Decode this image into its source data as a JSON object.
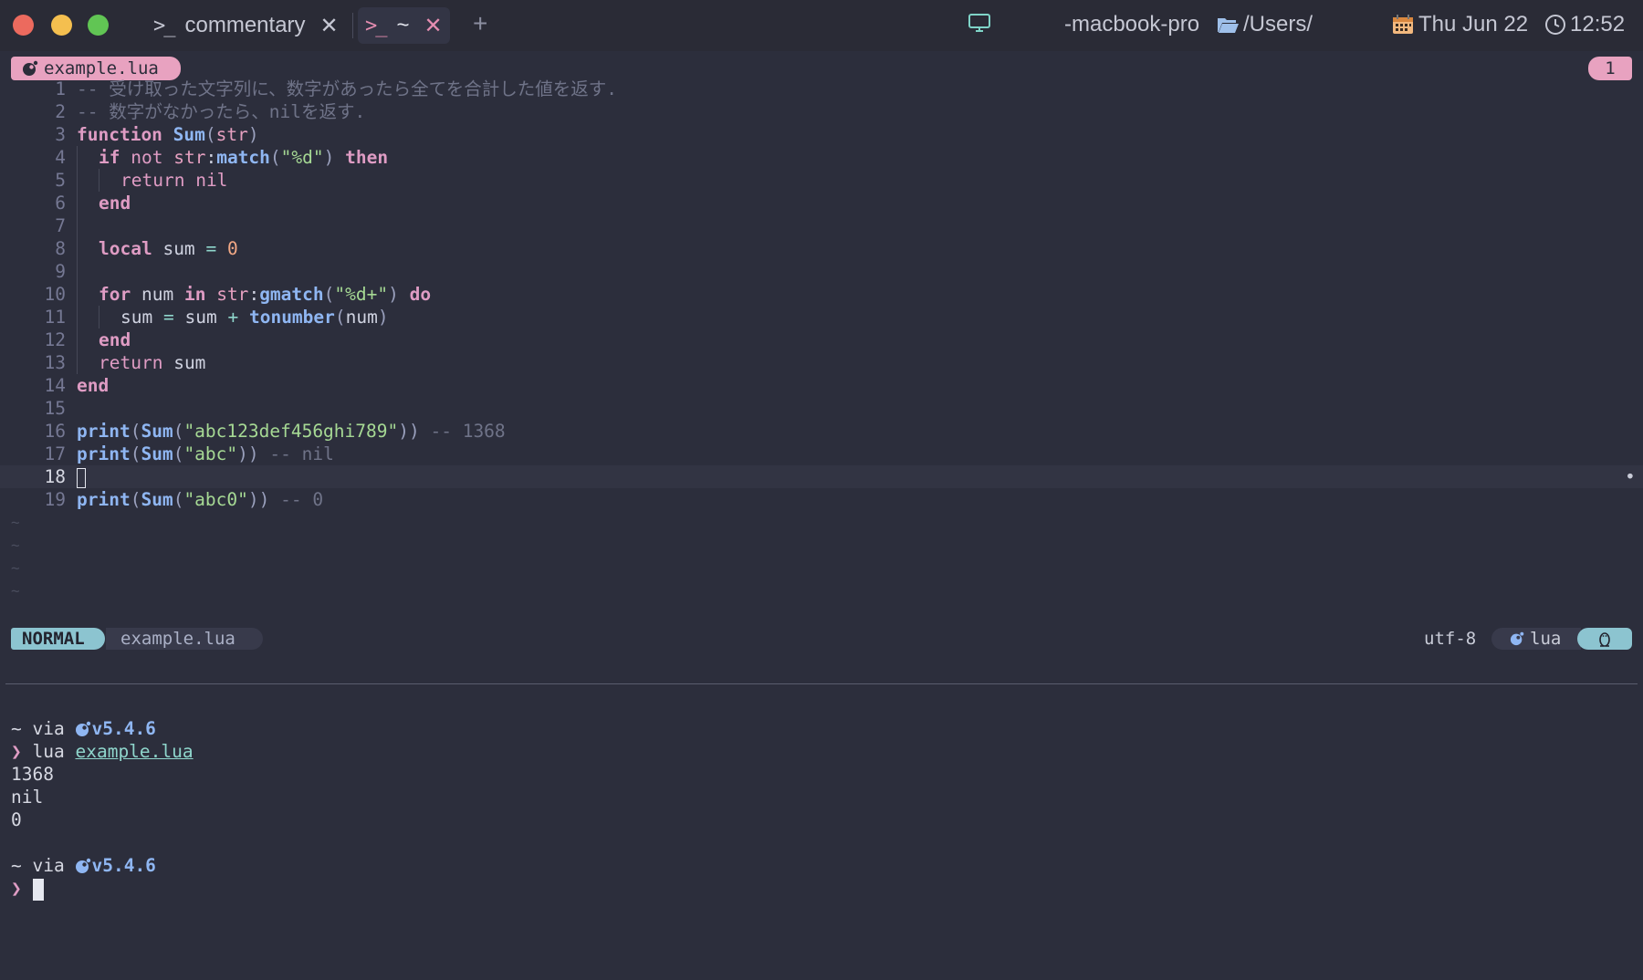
{
  "titlebar": {
    "tabs": [
      {
        "prompt": ">_",
        "label": "commentary",
        "close": "✕"
      },
      {
        "prompt": ">_",
        "label": "~",
        "close": "✕"
      }
    ],
    "new_tab": "+",
    "host": "-macbook-pro",
    "path": "/Users/",
    "date": "Thu Jun 22",
    "time": "12:52",
    "colors": {
      "red": "#ec6a5e",
      "yellow": "#f4bf4f",
      "green": "#61c554"
    }
  },
  "editor": {
    "buffer_name": "example.lua",
    "buffer_number": "1",
    "lines": [
      {
        "n": "1"
      },
      {
        "n": "2"
      },
      {
        "n": "3"
      },
      {
        "n": "4"
      },
      {
        "n": "5"
      },
      {
        "n": "6"
      },
      {
        "n": "7"
      },
      {
        "n": "8"
      },
      {
        "n": "9"
      },
      {
        "n": "10"
      },
      {
        "n": "11"
      },
      {
        "n": "12"
      },
      {
        "n": "13"
      },
      {
        "n": "14"
      },
      {
        "n": "15"
      },
      {
        "n": "16"
      },
      {
        "n": "17"
      },
      {
        "n": "18"
      },
      {
        "n": "19"
      }
    ],
    "code": {
      "c1": "-- 受け取った文字列に、数字があったら全てを合計した値を返す.",
      "c2": "-- 数字がなかったら、nilを返す.",
      "function": "function",
      "sum_name": "Sum",
      "str": "str",
      "if": "if",
      "not": "not",
      "match": "match",
      "pat_d": "\"%d\"",
      "then": "then",
      "return": "return",
      "nil": "nil",
      "end": "end",
      "local": "local",
      "sum": "sum",
      "eq": "=",
      "zero": "0",
      "for": "for",
      "num": "num",
      "in": "in",
      "gmatch": "gmatch",
      "pat_dplus": "\"%d+\"",
      "do": "do",
      "plus": "+",
      "tonumber": "tonumber",
      "print": "print",
      "arg1": "\"abc123def456ghi789\"",
      "res1": "-- 1368",
      "arg2": "\"abc\"",
      "res2": "-- nil",
      "arg3": "\"abc0\"",
      "res3": "-- 0"
    },
    "tildes": [
      "~",
      "~",
      "~",
      "~"
    ]
  },
  "statusline": {
    "mode": "NORMAL",
    "file": "example.lua",
    "encoding": "utf-8",
    "filetype": "lua",
    "os_icon": "tux-icon"
  },
  "shell": {
    "home": "~",
    "via": "via",
    "lua_version": "v5.4.6",
    "prompt_char": "❯",
    "command": "lua",
    "command_arg": "example.lua",
    "output": [
      "1368",
      "nil",
      "0"
    ]
  }
}
